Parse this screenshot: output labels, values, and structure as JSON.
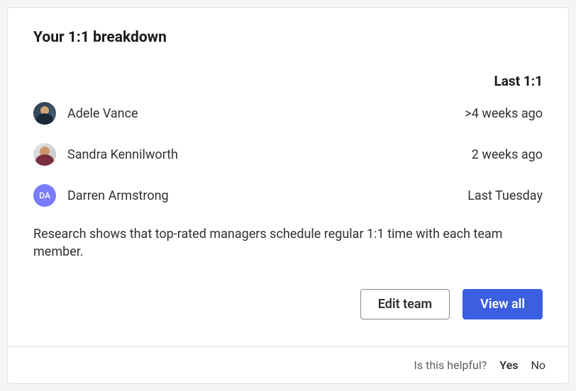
{
  "title": "Your 1:1 breakdown",
  "header": {
    "last_label": "Last 1:1"
  },
  "people": [
    {
      "name": "Adele Vance",
      "time": ">4 weeks ago",
      "avatar_type": "photo1"
    },
    {
      "name": "Sandra Kennilworth",
      "time": "2 weeks ago",
      "avatar_type": "photo2"
    },
    {
      "name": "Darren Armstrong",
      "time": "Last Tuesday",
      "avatar_type": "initials",
      "initials": "DA"
    }
  ],
  "research_text": "Research shows that top-rated managers schedule regular 1:1 time with each team member.",
  "buttons": {
    "edit_team": "Edit team",
    "view_all": "View all"
  },
  "helpful": {
    "prompt": "Is this helpful?",
    "yes": "Yes",
    "no": "No"
  }
}
